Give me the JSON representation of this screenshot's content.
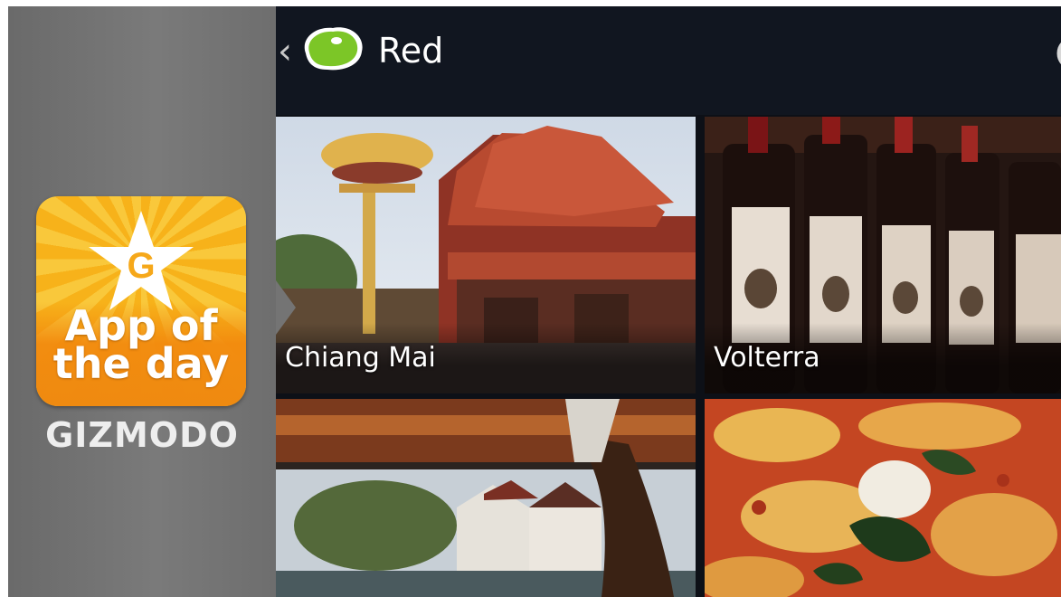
{
  "promo": {
    "badge_letter": "G",
    "badge_line1": "App of",
    "badge_line2": "the day",
    "brand": "GIZMODO"
  },
  "app": {
    "title": "Red",
    "back_icon": "chevron-left-icon",
    "logo_icon": "green-blob-logo-icon",
    "refresh_icon": "refresh-icon"
  },
  "tiles": [
    {
      "label": "Chiang Mai"
    },
    {
      "label": "Volterra"
    },
    {
      "label": ""
    },
    {
      "label": ""
    }
  ]
}
